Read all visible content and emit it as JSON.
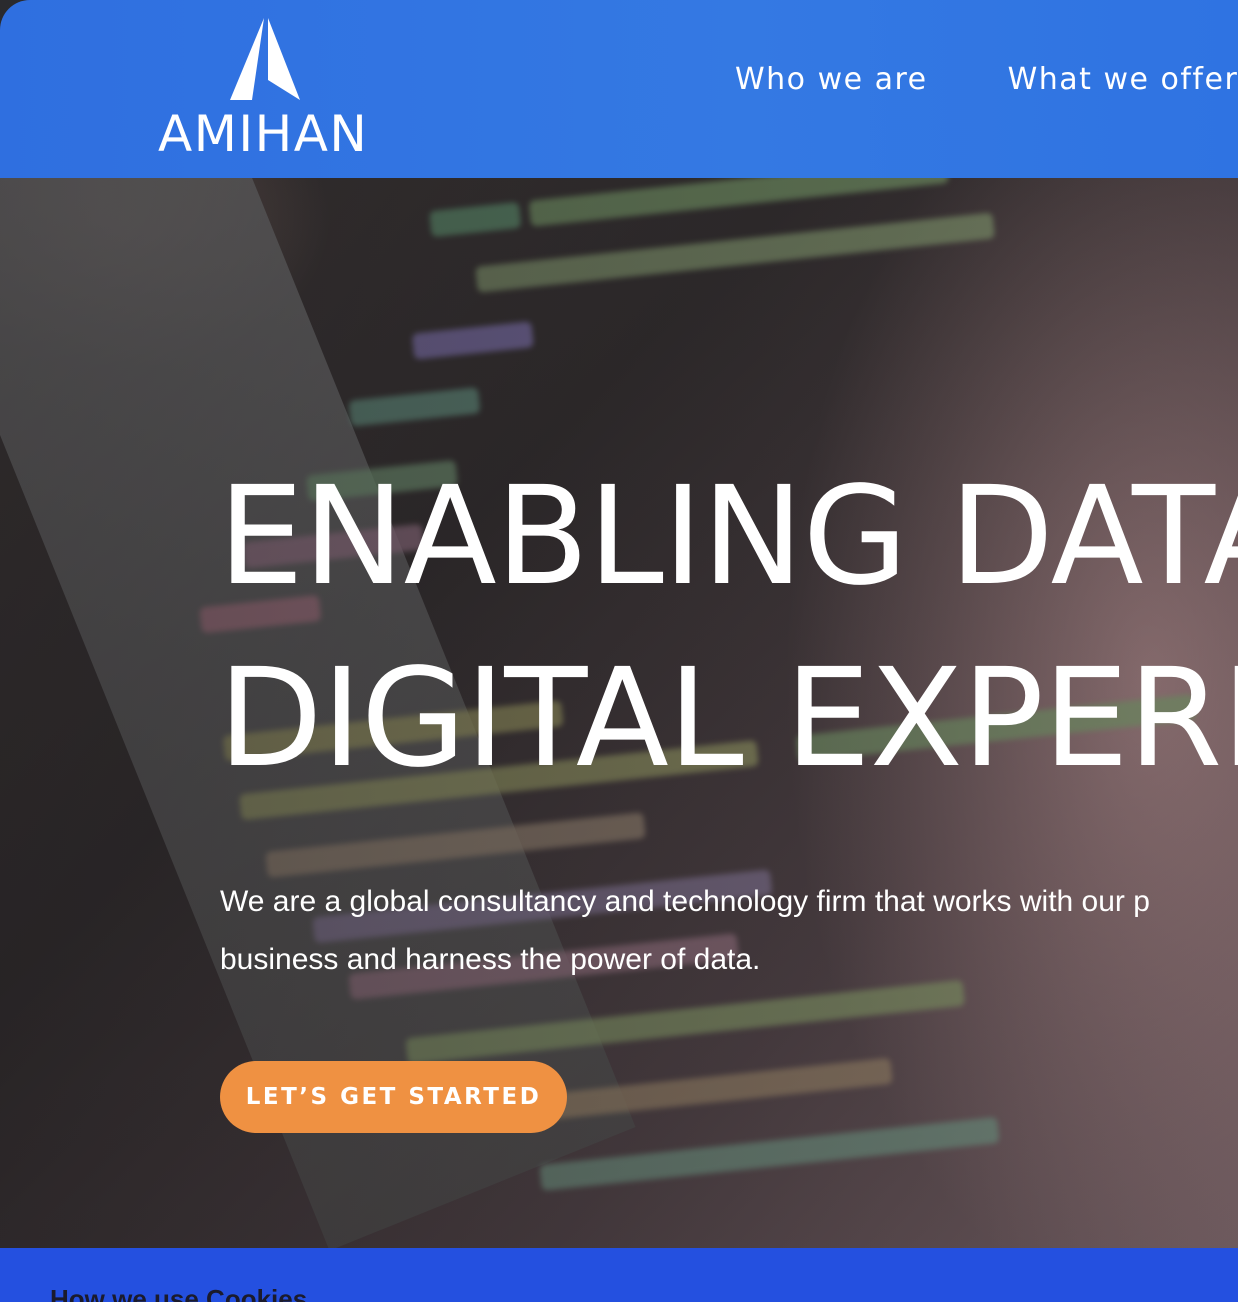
{
  "header": {
    "logo_text": "AMIHAN",
    "nav": [
      {
        "label": "Who we are",
        "has_dropdown": false
      },
      {
        "label": "What we offer",
        "has_dropdown": true
      }
    ]
  },
  "hero": {
    "headline_line1": "ENABLING DATA",
    "headline_line2": "DIGITAL EXPERIE",
    "subtext_line1": "We are a global consultancy and technology firm that works with our p",
    "subtext_line2": "business and harness the power of data.",
    "cta_label": "LET’S GET STARTED"
  },
  "cookie_banner": {
    "title": "How we use Cookies"
  },
  "colors": {
    "header_blue": "#3479e3",
    "cta_orange": "#ef9142",
    "cookie_blue": "#2450e0"
  },
  "icons": [
    "amihan-logo-mark",
    "chevron-down-icon"
  ]
}
